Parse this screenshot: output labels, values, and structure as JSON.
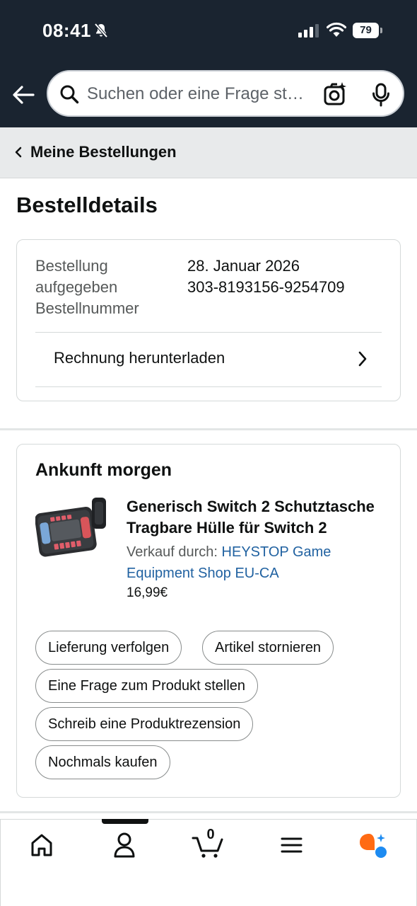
{
  "status_bar": {
    "time": "08:41",
    "battery": "79"
  },
  "search": {
    "placeholder": "Suchen oder eine Frage st…"
  },
  "breadcrumb": {
    "label": "Meine Bestellungen"
  },
  "page": {
    "title": "Bestelldetails"
  },
  "order_info": {
    "labels": [
      "Bestellung aufgegeben",
      "Bestellnummer"
    ],
    "order_date": "28. Januar 2026",
    "order_number": "303-8193156-9254709",
    "invoice_label": "Rechnung herunterladen"
  },
  "shipment": {
    "status": "Ankunft morgen",
    "product": {
      "title": "Generisch Switch 2 Schutztasche Tragbare Hülle für Switch 2",
      "sold_by_prefix": "Verkauf durch: ",
      "seller": "HEYSTOP Game Equipment Shop EU-CA",
      "price": "16,99€"
    },
    "actions": {
      "track": "Lieferung verfolgen",
      "cancel": "Artikel stornieren",
      "ask": "Eine Frage zum Produkt stellen",
      "review": "Schreib eine Produktrezension",
      "buy_again": "Nochmals kaufen"
    }
  },
  "bottom_nav": {
    "cart_count": "0"
  },
  "colors": {
    "header_bg": "#1a2430",
    "link": "#2162a1",
    "breadcrumb_bg": "#e8eaeb",
    "rufus_orange": "#ff6a13",
    "rufus_blue": "#1d8bf1"
  }
}
